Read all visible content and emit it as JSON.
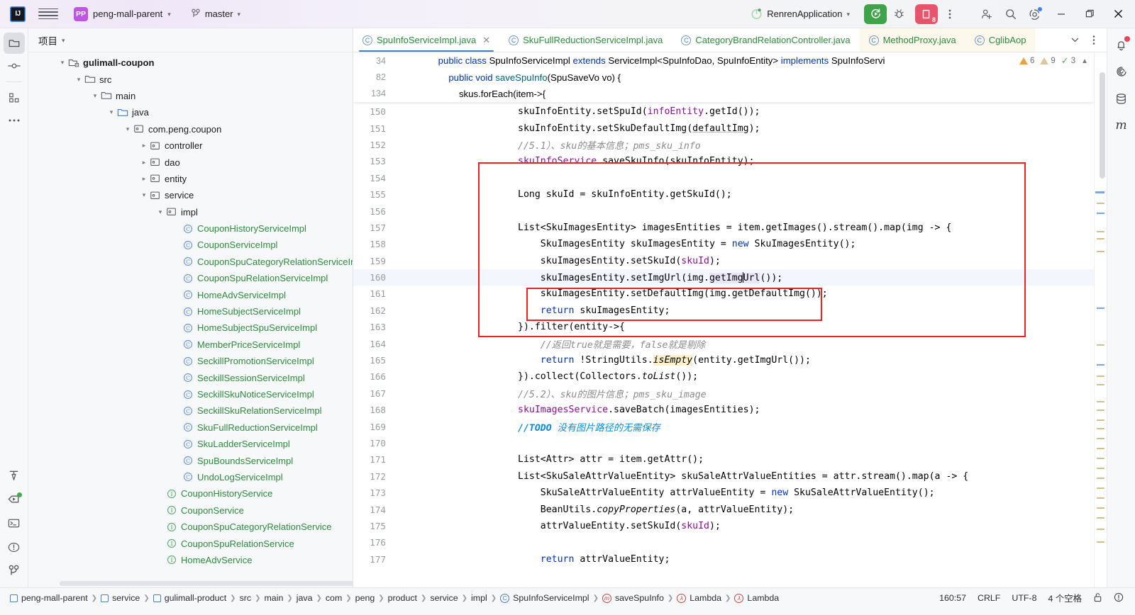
{
  "titlebar": {
    "logo_text": "IJ",
    "project_name": "peng-mall-parent",
    "project_badge": "PP",
    "branch": "master",
    "run_config": "RenrenApplication",
    "stop_count": "8"
  },
  "project_panel": {
    "title": "项目",
    "tree": [
      {
        "depth": 1,
        "arrow": "down",
        "icon": "module-folder-icon",
        "label": "gulimall-coupon",
        "bold": true,
        "kind": "module"
      },
      {
        "depth": 2,
        "arrow": "down",
        "icon": "folder-icon",
        "label": "src",
        "kind": "folder"
      },
      {
        "depth": 3,
        "arrow": "down",
        "icon": "folder-icon",
        "label": "main",
        "kind": "folder"
      },
      {
        "depth": 4,
        "arrow": "down",
        "icon": "source-folder-icon",
        "label": "java",
        "kind": "source"
      },
      {
        "depth": 5,
        "arrow": "down",
        "icon": "package-icon",
        "label": "com.peng.coupon",
        "kind": "package"
      },
      {
        "depth": 6,
        "arrow": "right",
        "icon": "package-icon",
        "label": "controller",
        "kind": "package"
      },
      {
        "depth": 6,
        "arrow": "right",
        "icon": "package-icon",
        "label": "dao",
        "kind": "package"
      },
      {
        "depth": 6,
        "arrow": "right",
        "icon": "package-icon",
        "label": "entity",
        "kind": "package"
      },
      {
        "depth": 6,
        "arrow": "down",
        "icon": "package-icon",
        "label": "service",
        "kind": "package"
      },
      {
        "depth": 7,
        "arrow": "down",
        "icon": "package-icon",
        "label": "impl",
        "kind": "package"
      },
      {
        "depth": 8,
        "arrow": "none",
        "icon": "class-icon",
        "label": "CouponHistoryServiceImpl",
        "kind": "class"
      },
      {
        "depth": 8,
        "arrow": "none",
        "icon": "class-icon",
        "label": "CouponServiceImpl",
        "kind": "class"
      },
      {
        "depth": 8,
        "arrow": "none",
        "icon": "class-icon",
        "label": "CouponSpuCategoryRelationServiceImpl",
        "kind": "class"
      },
      {
        "depth": 8,
        "arrow": "none",
        "icon": "class-icon",
        "label": "CouponSpuRelationServiceImpl",
        "kind": "class"
      },
      {
        "depth": 8,
        "arrow": "none",
        "icon": "class-icon",
        "label": "HomeAdvServiceImpl",
        "kind": "class"
      },
      {
        "depth": 8,
        "arrow": "none",
        "icon": "class-icon",
        "label": "HomeSubjectServiceImpl",
        "kind": "class"
      },
      {
        "depth": 8,
        "arrow": "none",
        "icon": "class-icon",
        "label": "HomeSubjectSpuServiceImpl",
        "kind": "class"
      },
      {
        "depth": 8,
        "arrow": "none",
        "icon": "class-icon",
        "label": "MemberPriceServiceImpl",
        "kind": "class"
      },
      {
        "depth": 8,
        "arrow": "none",
        "icon": "class-icon",
        "label": "SeckillPromotionServiceImpl",
        "kind": "class"
      },
      {
        "depth": 8,
        "arrow": "none",
        "icon": "class-icon",
        "label": "SeckillSessionServiceImpl",
        "kind": "class"
      },
      {
        "depth": 8,
        "arrow": "none",
        "icon": "class-icon",
        "label": "SeckillSkuNoticeServiceImpl",
        "kind": "class"
      },
      {
        "depth": 8,
        "arrow": "none",
        "icon": "class-icon",
        "label": "SeckillSkuRelationServiceImpl",
        "kind": "class"
      },
      {
        "depth": 8,
        "arrow": "none",
        "icon": "class-icon",
        "label": "SkuFullReductionServiceImpl",
        "kind": "class"
      },
      {
        "depth": 8,
        "arrow": "none",
        "icon": "class-icon",
        "label": "SkuLadderServiceImpl",
        "kind": "class"
      },
      {
        "depth": 8,
        "arrow": "none",
        "icon": "class-icon",
        "label": "SpuBoundsServiceImpl",
        "kind": "class"
      },
      {
        "depth": 8,
        "arrow": "none",
        "icon": "class-icon",
        "label": "UndoLogServiceImpl",
        "kind": "class"
      },
      {
        "depth": 7,
        "arrow": "none",
        "icon": "interface-icon",
        "label": "CouponHistoryService",
        "kind": "interface"
      },
      {
        "depth": 7,
        "arrow": "none",
        "icon": "interface-icon",
        "label": "CouponService",
        "kind": "interface"
      },
      {
        "depth": 7,
        "arrow": "none",
        "icon": "interface-icon",
        "label": "CouponSpuCategoryRelationService",
        "kind": "interface"
      },
      {
        "depth": 7,
        "arrow": "none",
        "icon": "interface-icon",
        "label": "CouponSpuRelationService",
        "kind": "interface"
      },
      {
        "depth": 7,
        "arrow": "none",
        "icon": "interface-icon",
        "label": "HomeAdvService",
        "kind": "interface"
      }
    ]
  },
  "tabs": [
    {
      "label": "SpuInfoServiceImpl.java",
      "active": true,
      "closable": true,
      "pinned": false
    },
    {
      "label": "SkuFullReductionServiceImpl.java",
      "active": false,
      "closable": false,
      "pinned": false
    },
    {
      "label": "CategoryBrandRelationController.java",
      "active": false,
      "closable": false,
      "pinned": false
    },
    {
      "label": "MethodProxy.java",
      "active": false,
      "closable": false,
      "pinned": true
    },
    {
      "label": "CglibAop",
      "active": false,
      "closable": false,
      "pinned": true
    }
  ],
  "inspection": {
    "warnings_strong": "6",
    "warnings_weak": "9",
    "checks": "3"
  },
  "editor": {
    "sticky_lines": [
      {
        "num": "34",
        "indent": 1,
        "html": "<span class=\"kw\">public class</span> SpuInfoServiceImpl <span class=\"kw\">extends</span> ServiceImpl&lt;SpuInfoDao, SpuInfoEntity&gt; <span class=\"kw\">implements</span> SpuInfoServi"
      },
      {
        "num": "82",
        "indent": 2,
        "html": "<span class=\"kw\">public void</span> <span class=\"mcall\">saveSpuInfo</span>(SpuSaveVo vo) {"
      },
      {
        "num": "134",
        "indent": 3,
        "html": "skus.forEach(item-&gt;{"
      }
    ],
    "lines": [
      {
        "num": "150",
        "indent": 4,
        "html": "skuInfoEntity.setSpuId(<span class=\"fld\">infoEntity</span>.getId());"
      },
      {
        "num": "151",
        "indent": 4,
        "html": "skuInfoEntity.setSkuDefaultImg(<span class=\"und\">defaultImg</span>);"
      },
      {
        "num": "152",
        "indent": 4,
        "html": "<span class=\"cmt\">//5.1）、sku的基本信息；pms_sku_info</span>"
      },
      {
        "num": "153",
        "indent": 4,
        "html": "<span class=\"svcf\">skuInfoService</span>.saveSkuInfo(skuInfoEntity);"
      },
      {
        "num": "154",
        "indent": 0,
        "html": ""
      },
      {
        "num": "155",
        "indent": 4,
        "html": "Long skuId = skuInfoEntity.getSkuId();"
      },
      {
        "num": "156",
        "indent": 0,
        "html": ""
      },
      {
        "num": "157",
        "indent": 4,
        "html": "List&lt;SkuImagesEntity&gt; imagesEntities = item.getImages().stream().map(img -&gt; {"
      },
      {
        "num": "158",
        "indent": 5,
        "html": "SkuImagesEntity skuImagesEntity = <span class=\"kw\">new</span> SkuImagesEntity();"
      },
      {
        "num": "159",
        "indent": 5,
        "html": "skuImagesEntity.setSkuId(<span class=\"fld\">skuId</span>);"
      },
      {
        "num": "160",
        "indent": 5,
        "html": "skuImagesEntity.setImgUrl(img.<span class=\"caretsel\">getImg</span><span class=\"caret\"></span><span class=\"caretsel\">Url</span>());",
        "current": true
      },
      {
        "num": "161",
        "indent": 5,
        "html": "skuImagesEntity.setDefaultImg(img.getDefaultImg());"
      },
      {
        "num": "162",
        "indent": 5,
        "html": "<span class=\"kw\">return</span> skuImagesEntity;"
      },
      {
        "num": "163",
        "indent": 4,
        "html": "}).filter(entity-&gt;{"
      },
      {
        "num": "164",
        "indent": 5,
        "html": "<span class=\"cmt\">//返回true就是需要，false就是剔除</span>"
      },
      {
        "num": "165",
        "indent": 5,
        "html": "<span class=\"kw\">return</span> !StringUtils.<span class=\"ital hl\">isEmpty</span>(entity.getImgUrl());"
      },
      {
        "num": "166",
        "indent": 4,
        "html": "}).collect(Collectors.<span class=\"ital\">toList</span>());"
      },
      {
        "num": "167",
        "indent": 4,
        "html": "<span class=\"cmt\">//5.2）、sku的图片信息；pms_sku_image</span>"
      },
      {
        "num": "168",
        "indent": 4,
        "html": "<span class=\"svcf\">skuImagesService</span>.saveBatch(imagesEntities);"
      },
      {
        "num": "169",
        "indent": 4,
        "html": "<span class=\"todo\">//TODO</span> <span class=\"todotxt\">没有图片路径的无需保存</span>"
      },
      {
        "num": "170",
        "indent": 0,
        "html": ""
      },
      {
        "num": "171",
        "indent": 4,
        "html": "List&lt;Attr&gt; attr = item.getAttr();"
      },
      {
        "num": "172",
        "indent": 4,
        "html": "List&lt;SkuSaleAttrValueEntity&gt; skuSaleAttrValueEntities = attr.stream().map(a -&gt; {"
      },
      {
        "num": "173",
        "indent": 5,
        "html": "SkuSaleAttrValueEntity attrValueEntity = <span class=\"kw\">new</span> SkuSaleAttrValueEntity();"
      },
      {
        "num": "174",
        "indent": 5,
        "html": "BeanUtils.<span class=\"ital\">copyProperties</span>(a, attrValueEntity);"
      },
      {
        "num": "175",
        "indent": 5,
        "html": "attrValueEntity.setSkuId(<span class=\"fld\">skuId</span>);"
      },
      {
        "num": "176",
        "indent": 0,
        "html": ""
      },
      {
        "num": "177",
        "indent": 5,
        "html": "<span class=\"kw\">return</span> attrValueEntity;"
      }
    ]
  },
  "status_bar": {
    "breadcrumbs": [
      {
        "icon": "module-icon",
        "label": "peng-mall-parent"
      },
      {
        "icon": "module-icon",
        "label": "service"
      },
      {
        "icon": "module-icon",
        "label": "gulimall-product"
      },
      {
        "icon": "none",
        "label": "src"
      },
      {
        "icon": "none",
        "label": "main"
      },
      {
        "icon": "none",
        "label": "java"
      },
      {
        "icon": "none",
        "label": "com"
      },
      {
        "icon": "none",
        "label": "peng"
      },
      {
        "icon": "none",
        "label": "product"
      },
      {
        "icon": "none",
        "label": "service"
      },
      {
        "icon": "none",
        "label": "impl"
      },
      {
        "icon": "class-icon",
        "label": "SpuInfoServiceImpl"
      },
      {
        "icon": "method-icon",
        "label": "saveSpuInfo"
      },
      {
        "icon": "lambda-icon",
        "label": "Lambda"
      },
      {
        "icon": "lambda-icon",
        "label": "Lambda"
      }
    ],
    "caret_position": "160:57",
    "line_separator": "CRLF",
    "encoding": "UTF-8",
    "indent": "4 个空格"
  },
  "colors": {
    "accent_blue": "#3b7dd8",
    "annotation_red": "#ee2222",
    "run_green": "#3fa34a",
    "stop_red": "#e8546b",
    "brand_purple": "#bf55e0"
  }
}
